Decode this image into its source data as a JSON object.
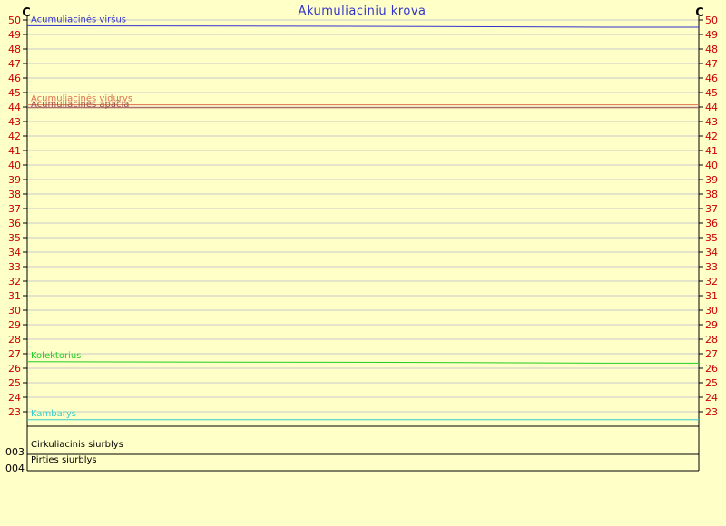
{
  "chart_data": {
    "type": "line",
    "title": "Akumuliaciniu krova",
    "unit_left": "C",
    "unit_right": "C",
    "ylim": [
      22,
      50
    ],
    "y_ticks": [
      23,
      24,
      25,
      26,
      27,
      28,
      29,
      30,
      31,
      32,
      33,
      34,
      35,
      36,
      37,
      38,
      39,
      40,
      41,
      42,
      43,
      44,
      45,
      46,
      47,
      48,
      49,
      50
    ],
    "grid": true,
    "colors": {
      "axis": "#000000",
      "grid": "#c8c8c8",
      "tick_label": "#cc0000",
      "title": "#3333cc"
    },
    "series": [
      {
        "name": "Acumuliacinės viršus",
        "color": "#3333cc",
        "x": [
          0,
          0.6,
          0.86,
          1.0
        ],
        "values": [
          49.6,
          49.55,
          49.5,
          49.5
        ]
      },
      {
        "name": "Acumuliacinės vidurys",
        "color": "#e07050",
        "x": [
          0,
          1.0
        ],
        "values": [
          44.15,
          44.15
        ]
      },
      {
        "name": "Acumuliacinės apačia",
        "color": "#a05050",
        "x": [
          0,
          1.0
        ],
        "values": [
          43.95,
          43.95
        ]
      },
      {
        "name": "Kolektorius",
        "color": "#22cc22",
        "x": [
          0,
          0.6,
          0.86,
          1.0
        ],
        "values": [
          26.45,
          26.4,
          26.35,
          26.35
        ]
      },
      {
        "name": "Kambarys",
        "color": "#33cccc",
        "x": [
          0,
          1.0
        ],
        "values": [
          22.45,
          22.45
        ]
      }
    ],
    "digital_series": [
      {
        "name": "Cirkuliacinis siurblys",
        "tick_label": "003",
        "color": "#000000",
        "values": [
          0,
          0
        ]
      },
      {
        "name": "Pirties siurblys",
        "tick_label": "004",
        "color": "#000000",
        "values": [
          0,
          0
        ]
      }
    ]
  }
}
